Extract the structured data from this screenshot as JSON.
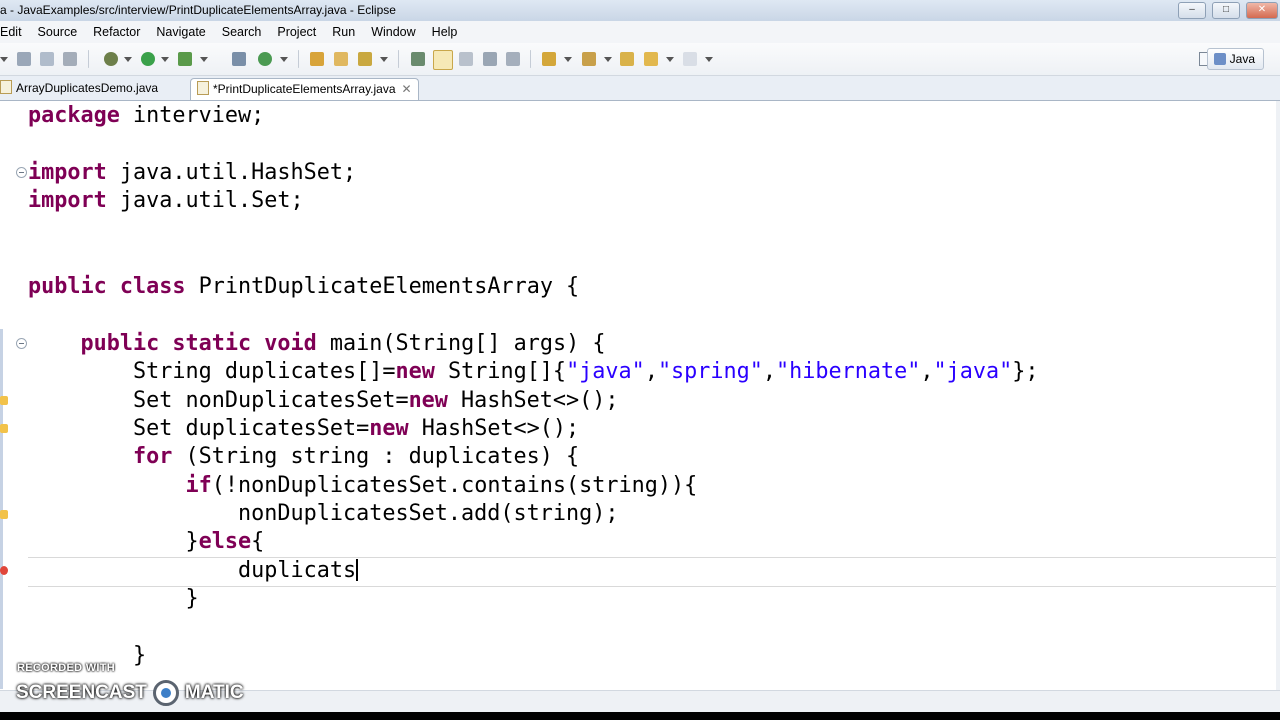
{
  "window": {
    "title": "a - JavaExamples/src/interview/PrintDuplicateElementsArray.java - Eclipse",
    "controls": [
      "–",
      "□",
      "✕"
    ]
  },
  "menu": [
    "Edit",
    "Source",
    "Refactor",
    "Navigate",
    "Search",
    "Project",
    "Run",
    "Window",
    "Help"
  ],
  "toolbar": {
    "perspective_label": "Java",
    "icons": [
      "save-icon",
      "save-all-icon",
      "print-icon",
      "debug-icon",
      "run-icon",
      "coverage-icon",
      "new-java-project-icon",
      "new-class-icon",
      "open-type-icon",
      "search-icon",
      "toggle-mark-occurrences-icon",
      "show-whitespace-icon",
      "next-annotation-icon",
      "previous-annotation-icon",
      "back-icon",
      "forward-icon",
      "open-perspective-icon"
    ]
  },
  "tabs": [
    {
      "label": "ArrayDuplicatesDemo.java",
      "active": false
    },
    {
      "label": "*PrintDuplicateElementsArray.java",
      "active": true,
      "close": "✕"
    }
  ],
  "editor": {
    "lines": [
      "package interview;",
      "",
      "import java.util.HashSet;",
      "import java.util.Set;",
      "",
      "",
      "public class PrintDuplicateElementsArray {",
      "",
      "    public static void main(String[] args) {",
      "        String duplicates[]=new String[]{\"java\",\"spring\",\"hibernate\",\"java\"};",
      "        Set nonDuplicatesSet=new HashSet<>();",
      "        Set duplicatesSet=new HashSet<>();",
      "        for (String string : duplicates) {",
      "            if(!nonDuplicatesSet.contains(string)){",
      "                nonDuplicatesSet.add(string);",
      "            }else{",
      "                duplicats",
      "            }",
      "",
      "        }"
    ]
  },
  "watermark": {
    "top": "RECORDED WITH",
    "left": "SCREENCAST",
    "right": "MATIC"
  },
  "colors": {
    "keyword": "#7f0055",
    "string": "#2a00ff",
    "error_marker": "#e0463a",
    "warning_marker": "#f2c24a"
  }
}
